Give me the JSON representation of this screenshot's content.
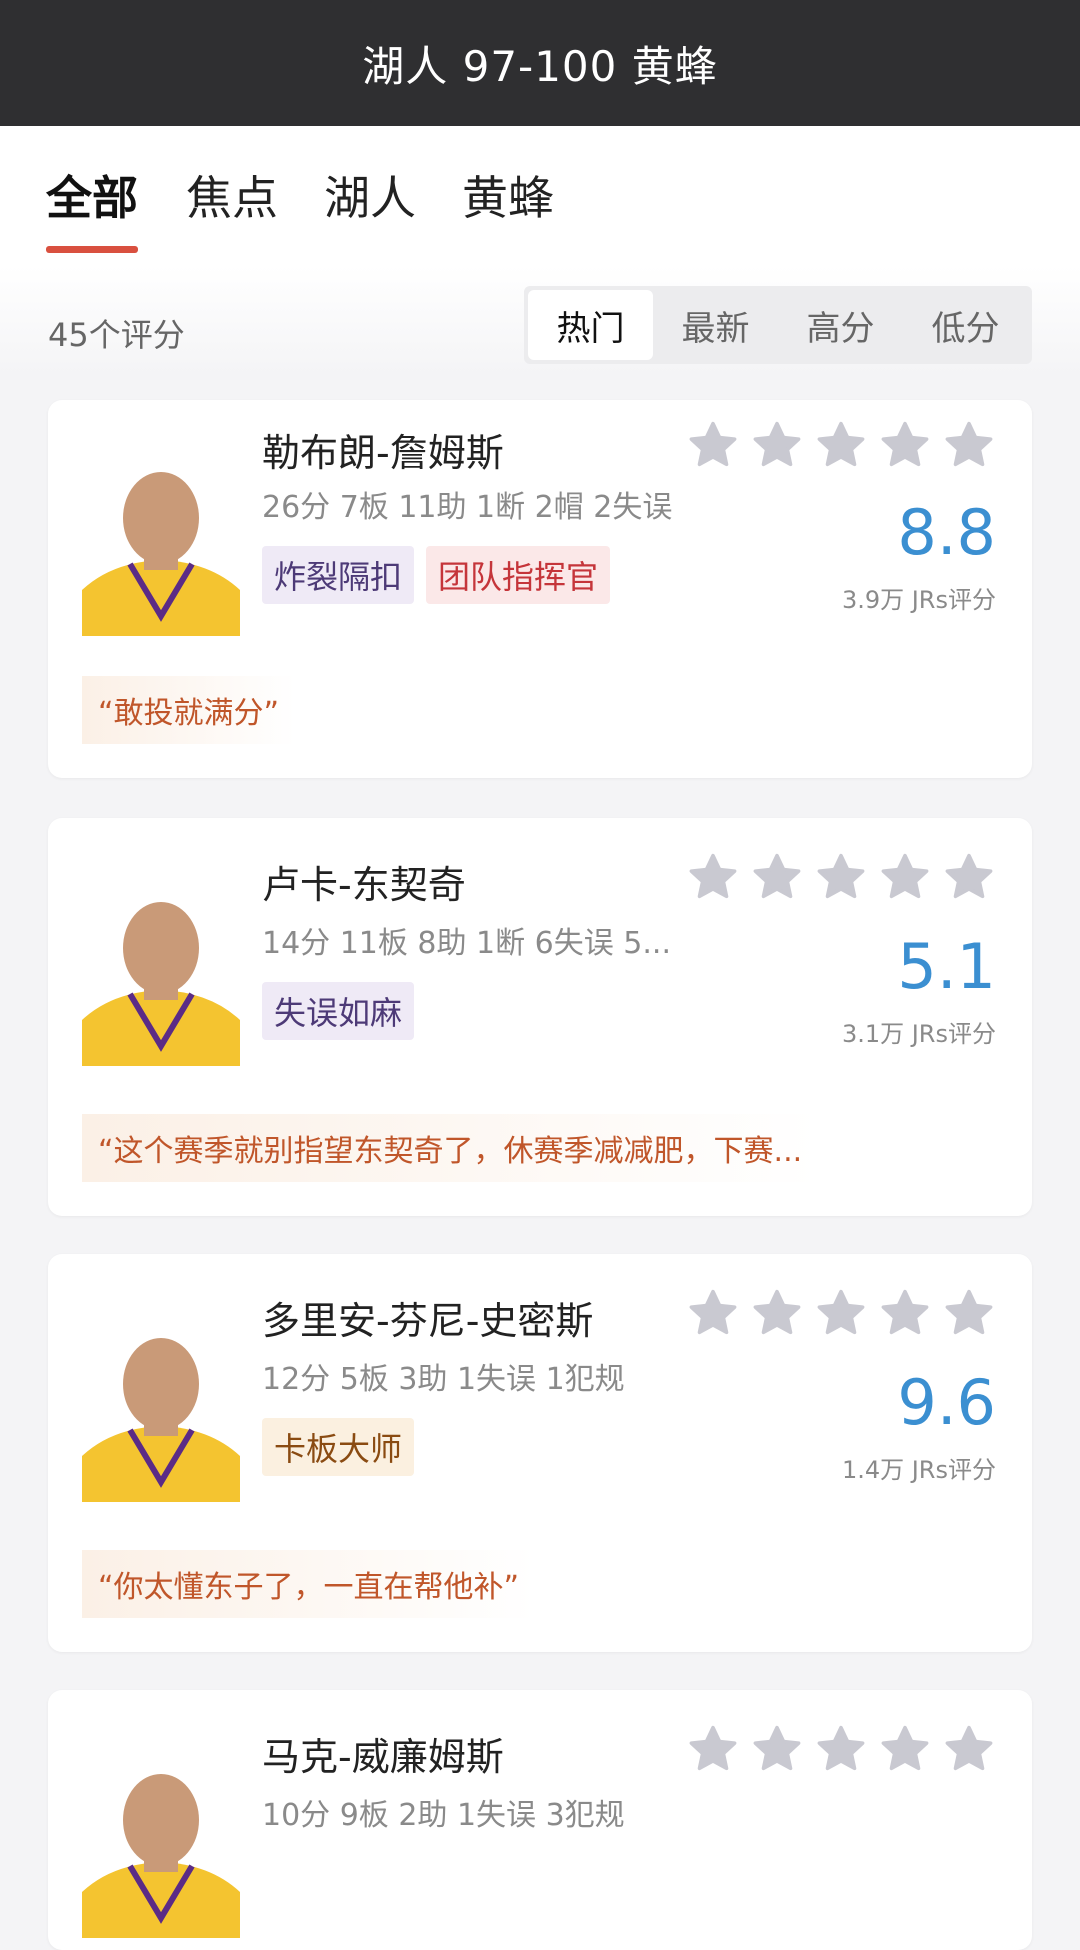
{
  "header": {
    "title": "湖人 97-100 黄蜂"
  },
  "tabs": [
    {
      "label": "全部"
    },
    {
      "label": "焦点"
    },
    {
      "label": "湖人"
    },
    {
      "label": "黄蜂"
    }
  ],
  "ratings": {
    "count_label": "45个评分",
    "sort_options": [
      {
        "label": "热门"
      },
      {
        "label": "最新"
      },
      {
        "label": "高分"
      },
      {
        "label": "低分"
      }
    ]
  },
  "players": [
    {
      "name": "勒布朗-詹姆斯",
      "stats": "26分 7板 11助 1断 2帽 2失误",
      "tags": [
        "炸裂隔扣",
        "团队指挥官"
      ],
      "score": "8.8",
      "votes": "3.9万 JRs评分",
      "quote": "“敢投就满分”"
    },
    {
      "name": "卢卡-东契奇",
      "stats": "14分 11板 8助 1断 6失误 5...",
      "tags": [
        "失误如麻"
      ],
      "score": "5.1",
      "votes": "3.1万 JRs评分",
      "quote": "“这个赛季就别指望东契奇了，休赛季减减肥，下赛..."
    },
    {
      "name": "多里安-芬尼-史密斯",
      "stats": "12分 5板 3助 1失误 1犯规",
      "tags": [
        "卡板大师"
      ],
      "score": "9.6",
      "votes": "1.4万 JRs评分",
      "quote": "“你太懂东子了，一直在帮他补”"
    },
    {
      "name": "马克-威廉姆斯",
      "stats": "10分 9板 2助 1失误 3犯规",
      "tags": [],
      "score": "",
      "votes": "",
      "quote": ""
    }
  ],
  "colors": {
    "accent": "#d9503f",
    "score": "#3b8fd1",
    "star": "#c8c8d0"
  },
  "icons": {
    "star": "star-icon",
    "avatar": "player-avatar"
  }
}
